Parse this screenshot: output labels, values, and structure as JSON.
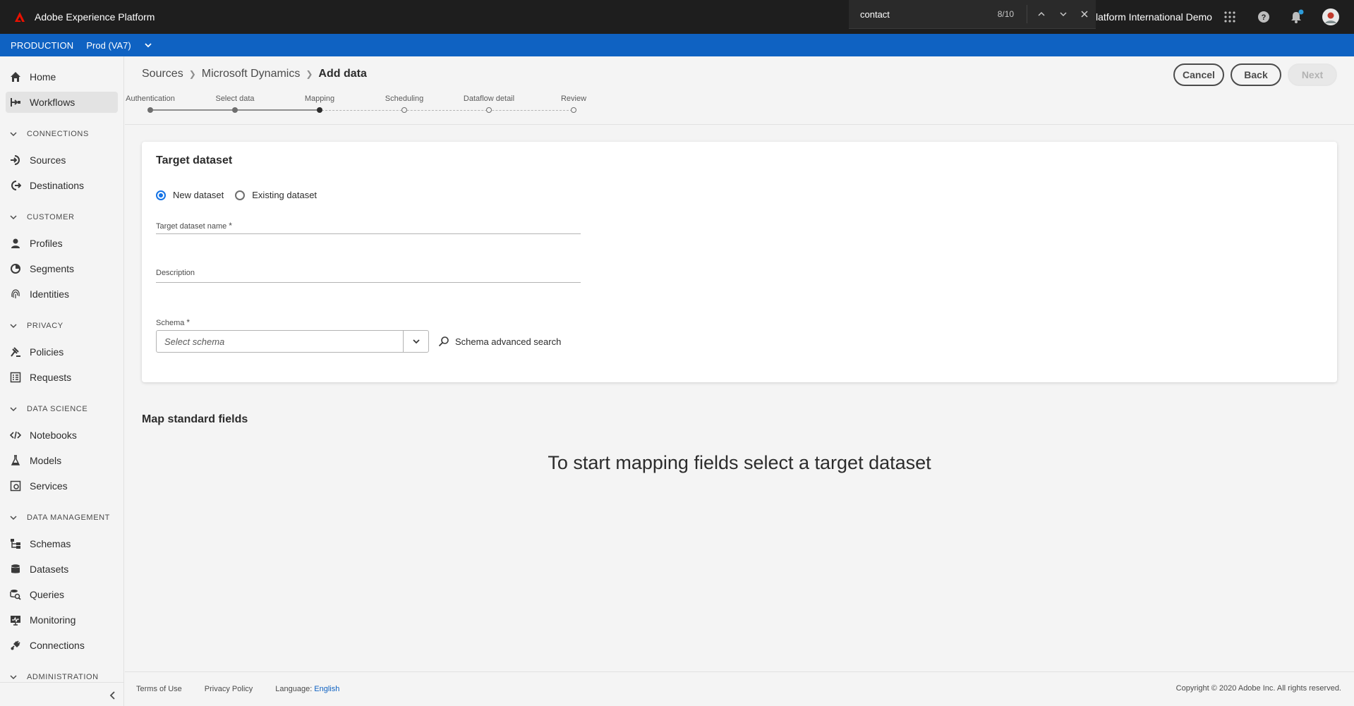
{
  "app": {
    "title": "Adobe Experience Platform",
    "org_name": "latform International Demo"
  },
  "find_bar": {
    "query": "contact",
    "count": "8/10"
  },
  "env": {
    "label": "PRODUCTION",
    "sandbox": "Prod (VA7)"
  },
  "sidebar": {
    "home": "Home",
    "workflows": "Workflows",
    "connections_section": "CONNECTIONS",
    "sources": "Sources",
    "destinations": "Destinations",
    "customer_section": "CUSTOMER",
    "profiles": "Profiles",
    "segments": "Segments",
    "identities": "Identities",
    "privacy_section": "PRIVACY",
    "policies": "Policies",
    "requests": "Requests",
    "data_science_section": "DATA SCIENCE",
    "notebooks": "Notebooks",
    "models": "Models",
    "services": "Services",
    "data_management_section": "DATA MANAGEMENT",
    "schemas": "Schemas",
    "datasets": "Datasets",
    "queries": "Queries",
    "monitoring": "Monitoring",
    "connections": "Connections",
    "administration_section": "ADMINISTRATION"
  },
  "breadcrumb": {
    "sources": "Sources",
    "connector": "Microsoft Dynamics",
    "current": "Add data"
  },
  "actions": {
    "cancel": "Cancel",
    "back": "Back",
    "next": "Next"
  },
  "steps": [
    {
      "label": "Authentication",
      "state": "done"
    },
    {
      "label": "Select data",
      "state": "done"
    },
    {
      "label": "Mapping",
      "state": "current"
    },
    {
      "label": "Scheduling",
      "state": "todo"
    },
    {
      "label": "Dataflow detail",
      "state": "todo"
    },
    {
      "label": "Review",
      "state": "todo"
    }
  ],
  "target_dataset": {
    "title": "Target dataset",
    "new_dataset": "New dataset",
    "existing_dataset": "Existing dataset",
    "selected": "New dataset",
    "name_label": "Target dataset name",
    "name_value": "",
    "description_label": "Description",
    "description_value": "",
    "schema_label": "Schema",
    "schema_placeholder": "Select schema",
    "advanced_search": "Schema advanced search",
    "required_mark": "*"
  },
  "mapping": {
    "title": "Map standard fields",
    "empty_message": "To start mapping fields select a target dataset"
  },
  "footer": {
    "terms": "Terms of Use",
    "privacy": "Privacy Policy",
    "language_label": "Language:",
    "language_value": "English",
    "copyright": "Copyright ©  2020 Adobe Inc.  All rights reserved."
  },
  "colors": {
    "topbar": "#1e1e1e",
    "envbar": "#0f62c2",
    "accent": "#1473e6",
    "adobe_red": "#eb1000"
  }
}
